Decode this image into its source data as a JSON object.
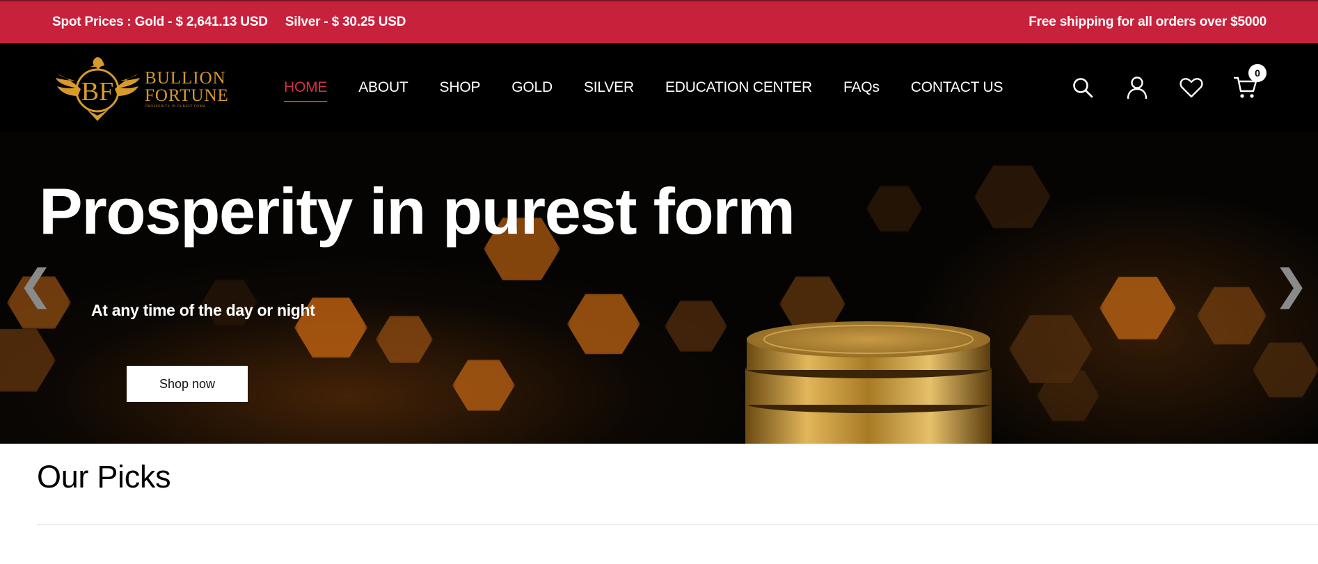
{
  "topbar": {
    "spot_label": "Spot Prices : Gold - $ 2,641.13 USD",
    "silver_label": "Silver - $ 30.25 USD",
    "shipping_text": "Free shipping for all orders over  $5000",
    "bg_color": "#c8213c"
  },
  "logo": {
    "monogram": "BF",
    "line1": "BULLION",
    "line2": "FORTUNE",
    "tagline": "PROSPERITY IN PUREST FORM"
  },
  "nav": {
    "items": [
      {
        "label": "HOME",
        "active": true
      },
      {
        "label": "ABOUT"
      },
      {
        "label": "SHOP"
      },
      {
        "label": "GOLD"
      },
      {
        "label": "SILVER"
      },
      {
        "label": "EDUCATION CENTER"
      },
      {
        "label": "FAQs"
      },
      {
        "label": "CONTACT US"
      }
    ],
    "active_color": "#d23244"
  },
  "header_icons": {
    "search": "search-icon",
    "account": "user-icon",
    "wishlist": "heart-icon",
    "cart": "cart-icon",
    "cart_count": "0"
  },
  "hero": {
    "title": "Prosperity in purest form",
    "subtitle": "At any time of the day or night",
    "cta_label": "Shop now",
    "prev_icon": "❮",
    "next_icon": "❯"
  },
  "section": {
    "title": "Our Picks"
  }
}
